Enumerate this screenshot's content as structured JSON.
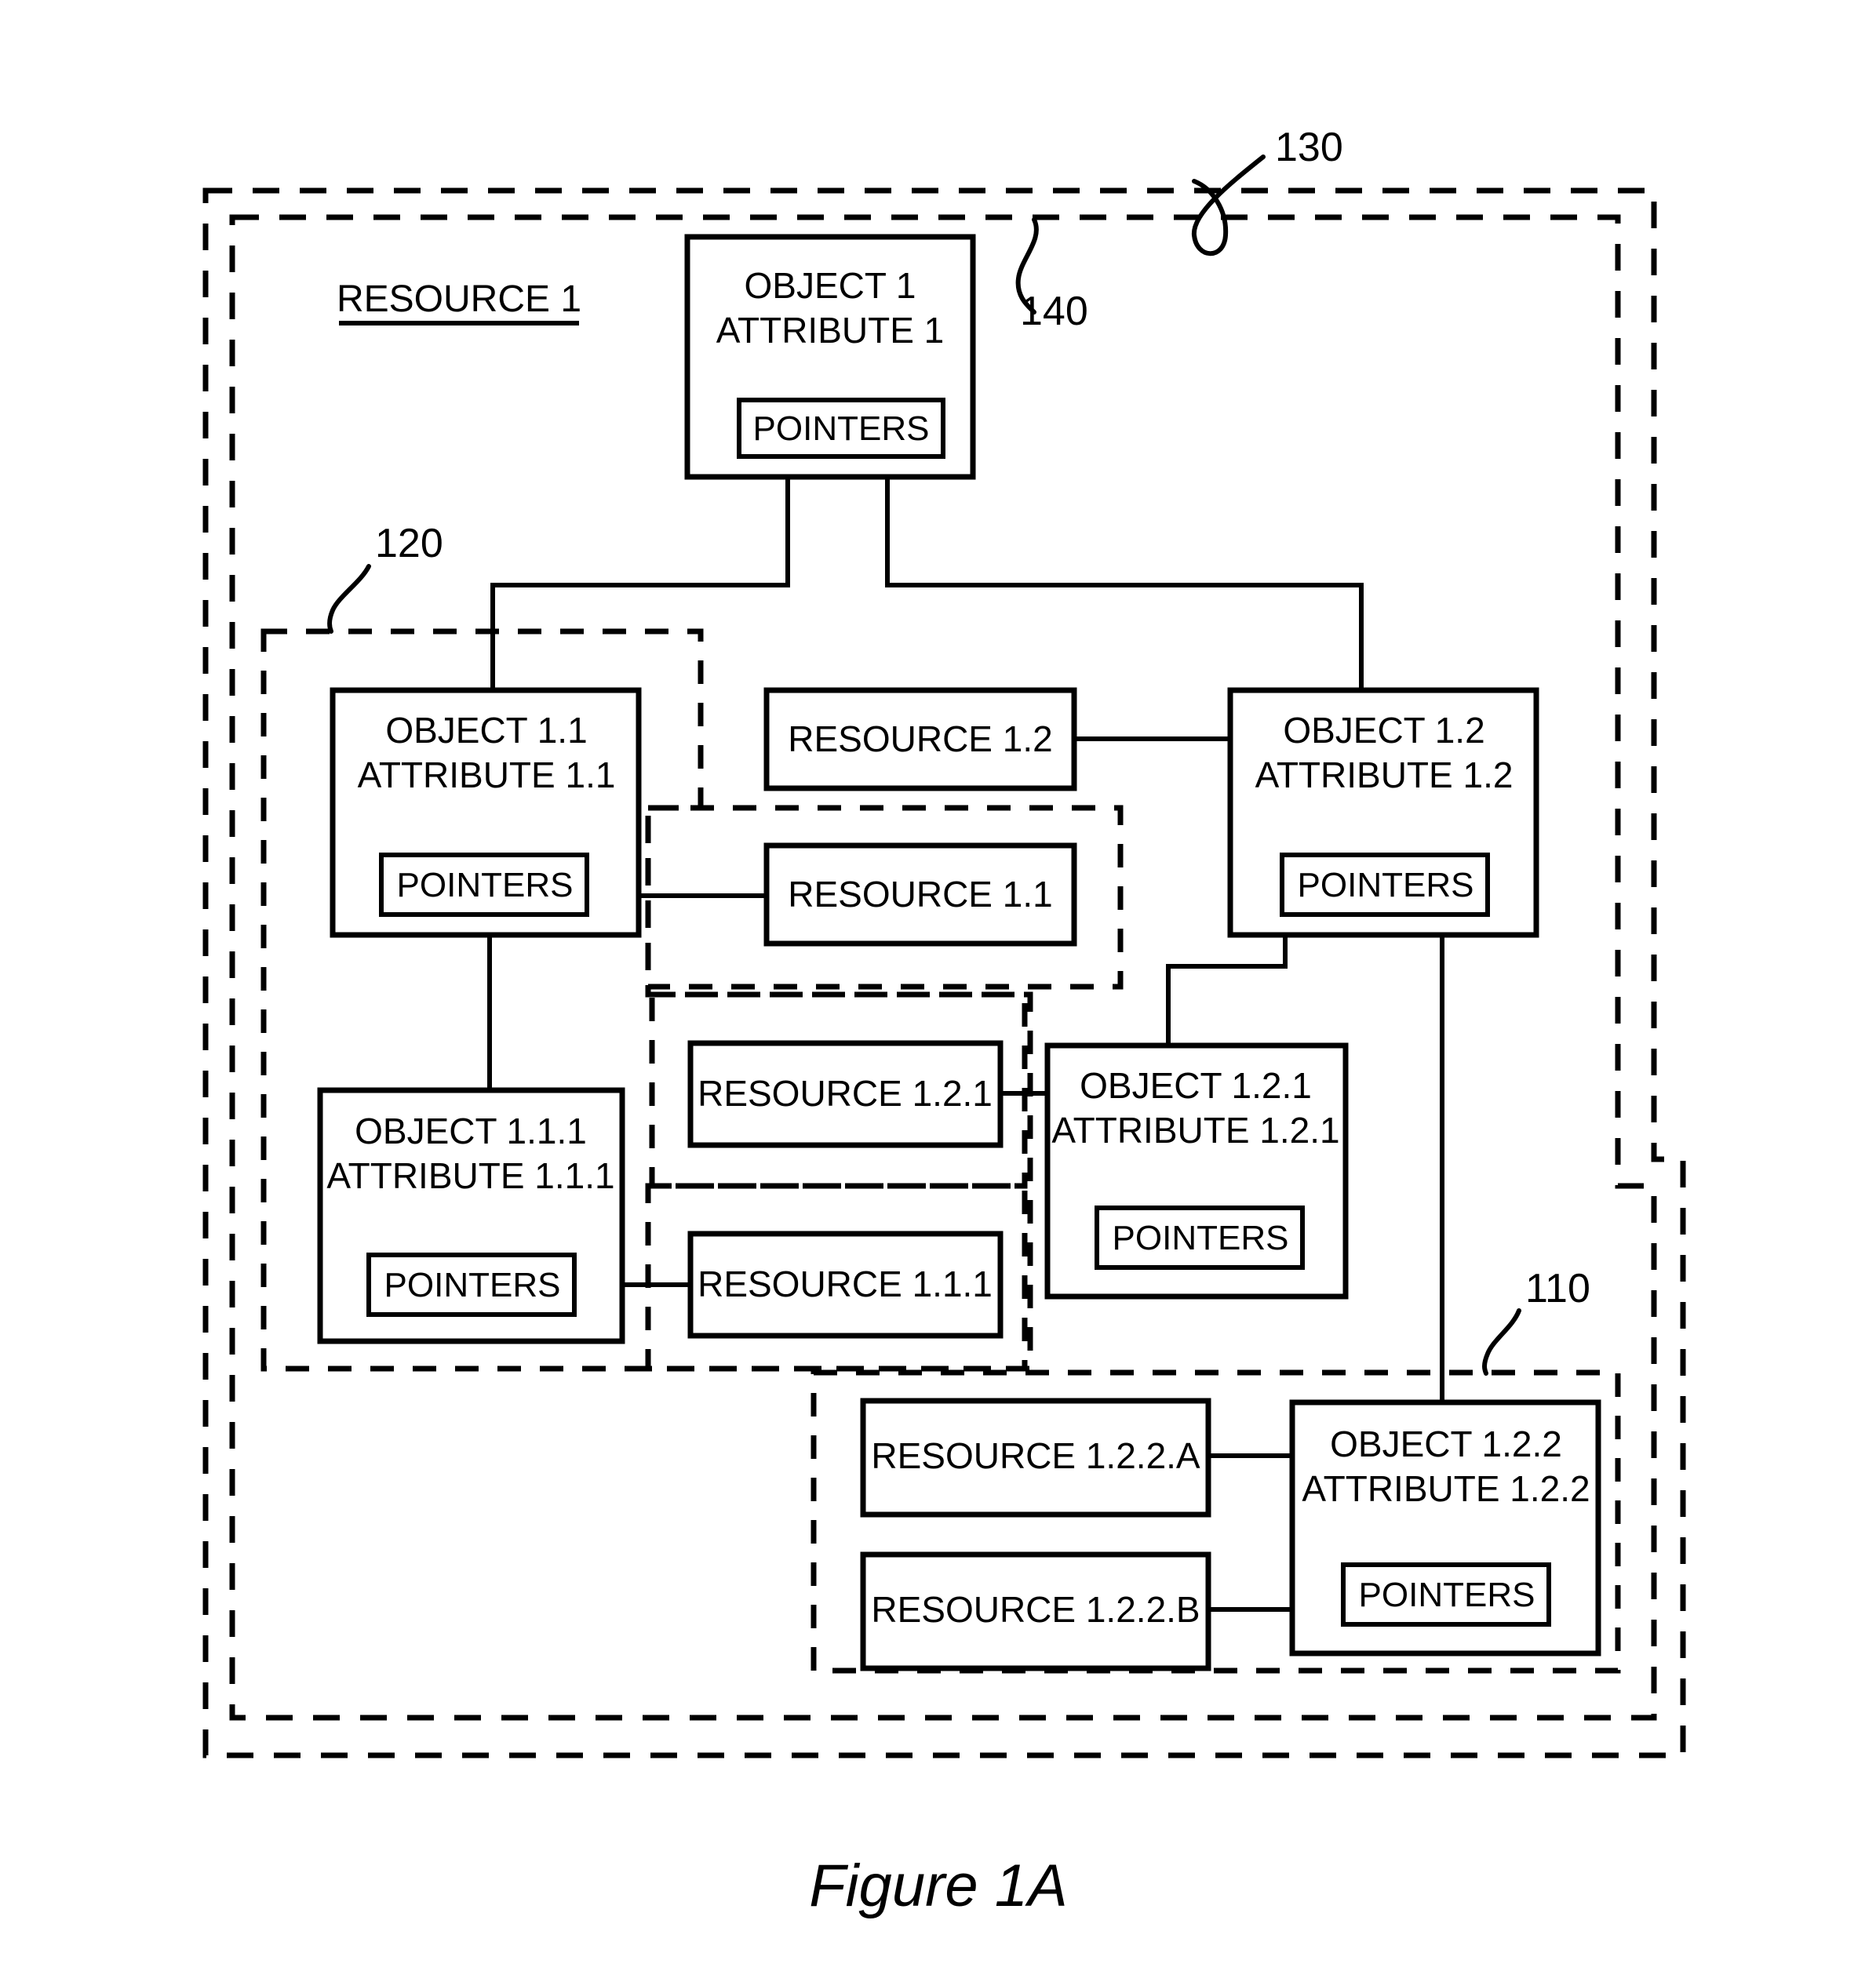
{
  "figure": {
    "caption": "Figure 1A",
    "resource_label": "RESOURCE 1"
  },
  "reference_numerals": {
    "outer_system": "130",
    "root_object": "140",
    "mid_group": "120",
    "lower_group": "110"
  },
  "pointers_label": "POINTERS",
  "objects": {
    "obj1": {
      "name": "OBJECT 1",
      "attribute": "ATTRIBUTE 1",
      "pointers": "POINTERS"
    },
    "obj1_1": {
      "name": "OBJECT 1.1",
      "attribute": "ATTRIBUTE 1.1",
      "pointers": "POINTERS"
    },
    "obj1_2": {
      "name": "OBJECT 1.2",
      "attribute": "ATTRIBUTE 1.2",
      "pointers": "POINTERS"
    },
    "obj1_1_1": {
      "name": "OBJECT 1.1.1",
      "attribute": "ATTRIBUTE 1.1.1",
      "pointers": "POINTERS"
    },
    "obj1_2_1": {
      "name": "OBJECT 1.2.1",
      "attribute": "ATTRIBUTE 1.2.1",
      "pointers": "POINTERS"
    },
    "obj1_2_2": {
      "name": "OBJECT 1.2.2",
      "attribute": "ATTRIBUTE 1.2.2",
      "pointers": "POINTERS"
    }
  },
  "resources": {
    "res1_2": "RESOURCE 1.2",
    "res1_1": "RESOURCE 1.1",
    "res1_2_1": "RESOURCE 1.2.1",
    "res1_1_1": "RESOURCE 1.1.1",
    "res1_2_2_a": "RESOURCE 1.2.2.A",
    "res1_2_2_b": "RESOURCE 1.2.2.B"
  },
  "colors": {
    "ink": "#000000",
    "paper": "#ffffff"
  }
}
